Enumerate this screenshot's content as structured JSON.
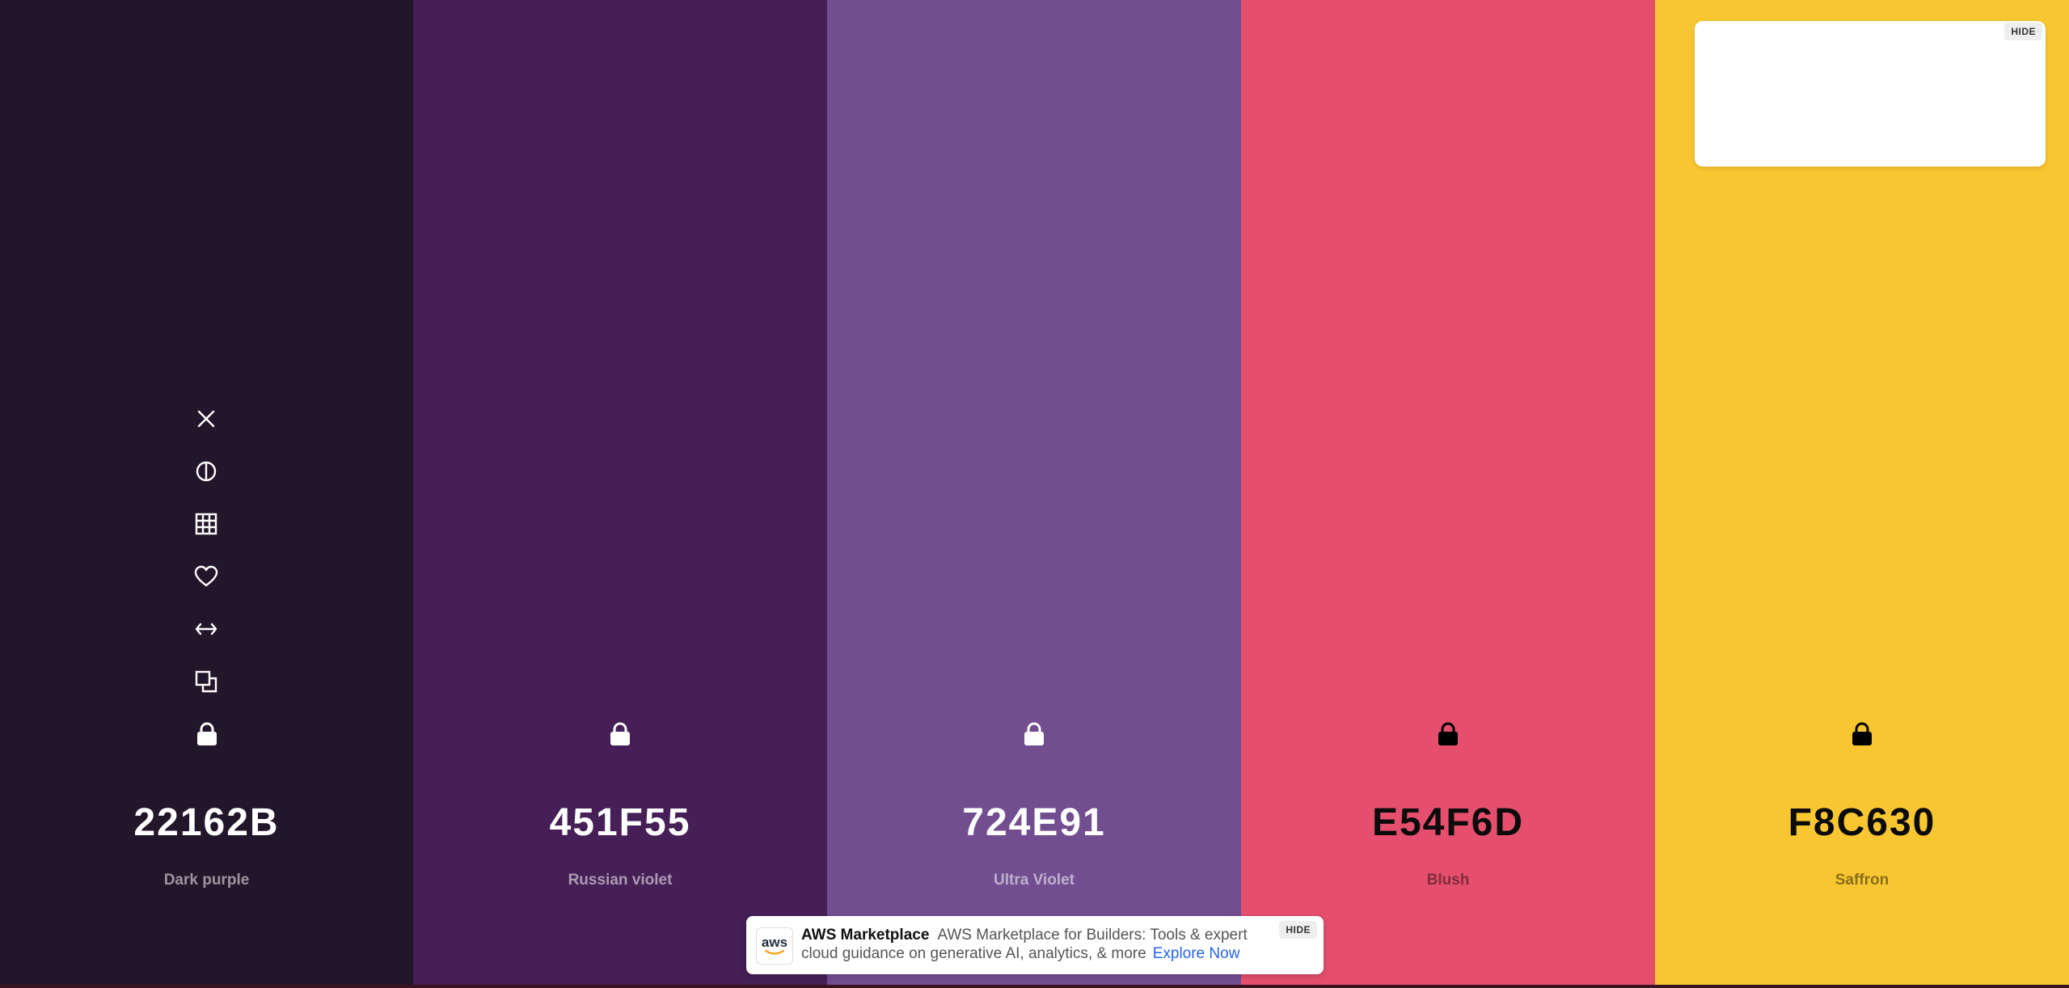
{
  "palette": {
    "colors": [
      {
        "hex": "22162B",
        "name": "Dark purple",
        "bg": "#22162B",
        "tone": "light"
      },
      {
        "hex": "451F55",
        "name": "Russian violet",
        "bg": "#451F55",
        "tone": "light"
      },
      {
        "hex": "724E91",
        "name": "Ultra Violet",
        "bg": "#724E91",
        "tone": "light"
      },
      {
        "hex": "E54F6D",
        "name": "Blush",
        "bg": "#E54F6D",
        "tone": "dark"
      },
      {
        "hex": "F8C630",
        "name": "Saffron",
        "bg": "#F8C630",
        "tone": "dark"
      }
    ]
  },
  "toolbar": {
    "icons": [
      "close-icon",
      "contrast-icon",
      "shades-grid-icon",
      "heart-icon",
      "drag-arrows-icon",
      "copy-icon",
      "lock-icon"
    ]
  },
  "ad": {
    "hide_label": "HIDE"
  },
  "banner": {
    "logo_text": "aws",
    "brand": "AWS Marketplace",
    "text": "AWS Marketplace for Builders: Tools & expert cloud guidance on generative AI, analytics, & more",
    "cta": "Explore Now",
    "hide_label": "HIDE"
  }
}
